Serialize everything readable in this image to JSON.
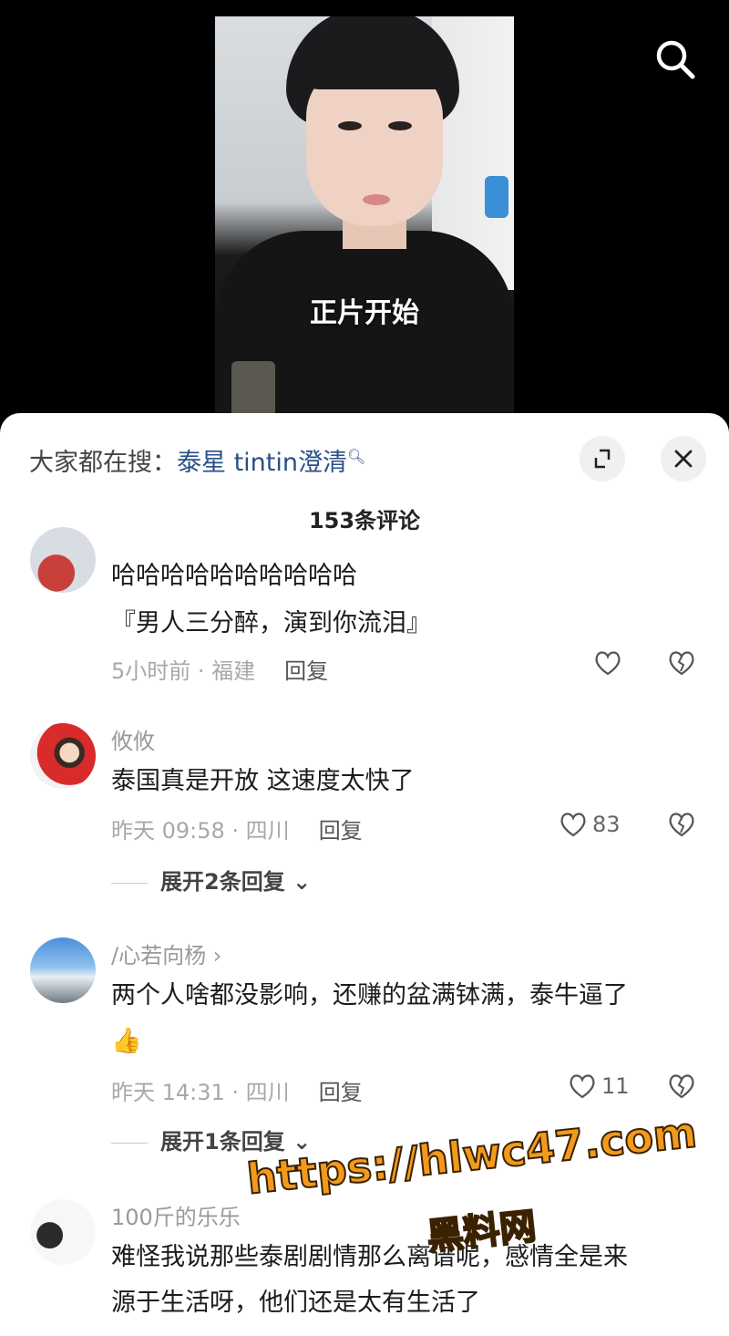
{
  "video": {
    "caption": "正片开始"
  },
  "sheet": {
    "hot_search_prefix": "大家都在搜：",
    "hot_search_link": "泰星 tintin澄清",
    "comment_count": "153条评论"
  },
  "comments": [
    {
      "text_line1": "哈哈哈哈哈哈哈哈哈哈",
      "text_line2": "『男人三分醉，演到你流泪』",
      "time_location": "5小时前 · 福建",
      "reply": "回复"
    },
    {
      "name": "攸攸",
      "text": "泰国真是开放 这速度太快了",
      "time_location": "昨天 09:58 · 四川",
      "reply": "回复",
      "likes": "83",
      "expand": "展开2条回复"
    },
    {
      "name": "/心若向杨",
      "text_line1": "两个人啥都没影响，还赚的盆满钵满，泰牛逼了",
      "emoji": "👍",
      "time_location": "昨天 14:31 · 四川",
      "reply": "回复",
      "likes": "11",
      "expand": "展开1条回复"
    },
    {
      "name": "100斤的乐乐",
      "text_line1": "难怪我说那些泰剧剧情那么离谱呢，感情全是来",
      "text_line2": "源于生活呀，他们还是太有生活了"
    }
  ],
  "watermark": {
    "url": "https://hlwc47.com",
    "site": "黑料网"
  },
  "colors": {
    "link": "#2b4f88",
    "watermark": "#f29a1c"
  }
}
